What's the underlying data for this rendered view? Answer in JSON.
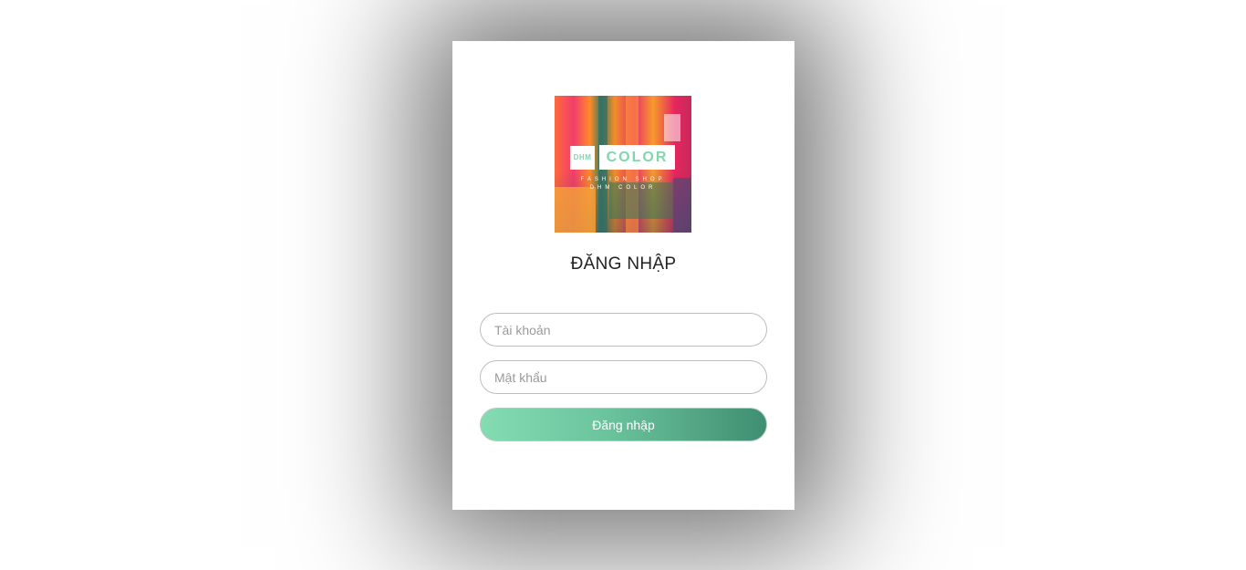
{
  "logo": {
    "badge_small": "DHM",
    "badge_big": "COLOR",
    "tagline_line1": "FASHION SHOP",
    "tagline_line2": "DHM COLOR"
  },
  "title": "ĐĂNG NHẬP",
  "username": {
    "placeholder": "Tài khoản",
    "value": ""
  },
  "password": {
    "placeholder": "Mật khẩu",
    "value": ""
  },
  "login_button": "Đăng nhập",
  "colors": {
    "button_gradient_start": "#84dcb3",
    "button_gradient_end": "#3f8e72",
    "logo_text": "#7fd7ac"
  }
}
